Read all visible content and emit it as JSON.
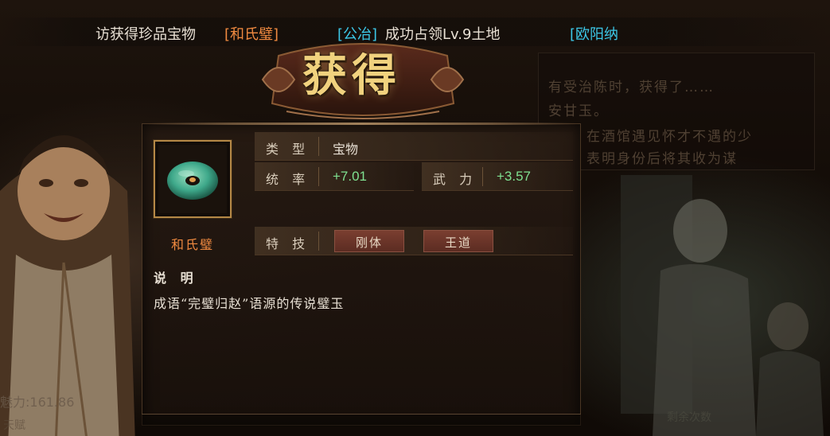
{
  "marquee": {
    "item1_prefix": "访获得珍品宝物",
    "item1_name": "[和氏璧]",
    "item2_player": "[公冶]",
    "item2_text": "成功占领Lv.9土地",
    "item3_player": "[欧阳纳"
  },
  "title": "获得",
  "item": {
    "name": "和氏璧",
    "icon": "jade-disc-icon"
  },
  "attributes": {
    "type_label": "类 型",
    "type_value": "宝物",
    "command_label": "统 率",
    "command_value": "+7.01",
    "force_label": "武 力",
    "force_value": "+3.57",
    "skill_label": "特 技",
    "skills": [
      "刚体",
      "王道"
    ]
  },
  "description": {
    "heading": "说 明",
    "text": "成语“完璧归赵”语源的传说璧玉"
  },
  "background": {
    "dialog_line1": "有受治陈时，获得了……",
    "dialog_line2": "安甘玉。",
    "dialog_line3": "在酒馆遇见怀才不遇的少",
    "dialog_line4": "表明身份后将其收为谋",
    "stat_text": "魅力:161.86",
    "stat_text2": "天赋",
    "bottom_right": "剩余次数"
  },
  "colors": {
    "title_gold": "#f1d27e",
    "item_orange": "#f08a40",
    "player_cyan": "#3cc8e8",
    "bonus_green": "#7fe090",
    "skill_red": "#6a3428"
  }
}
